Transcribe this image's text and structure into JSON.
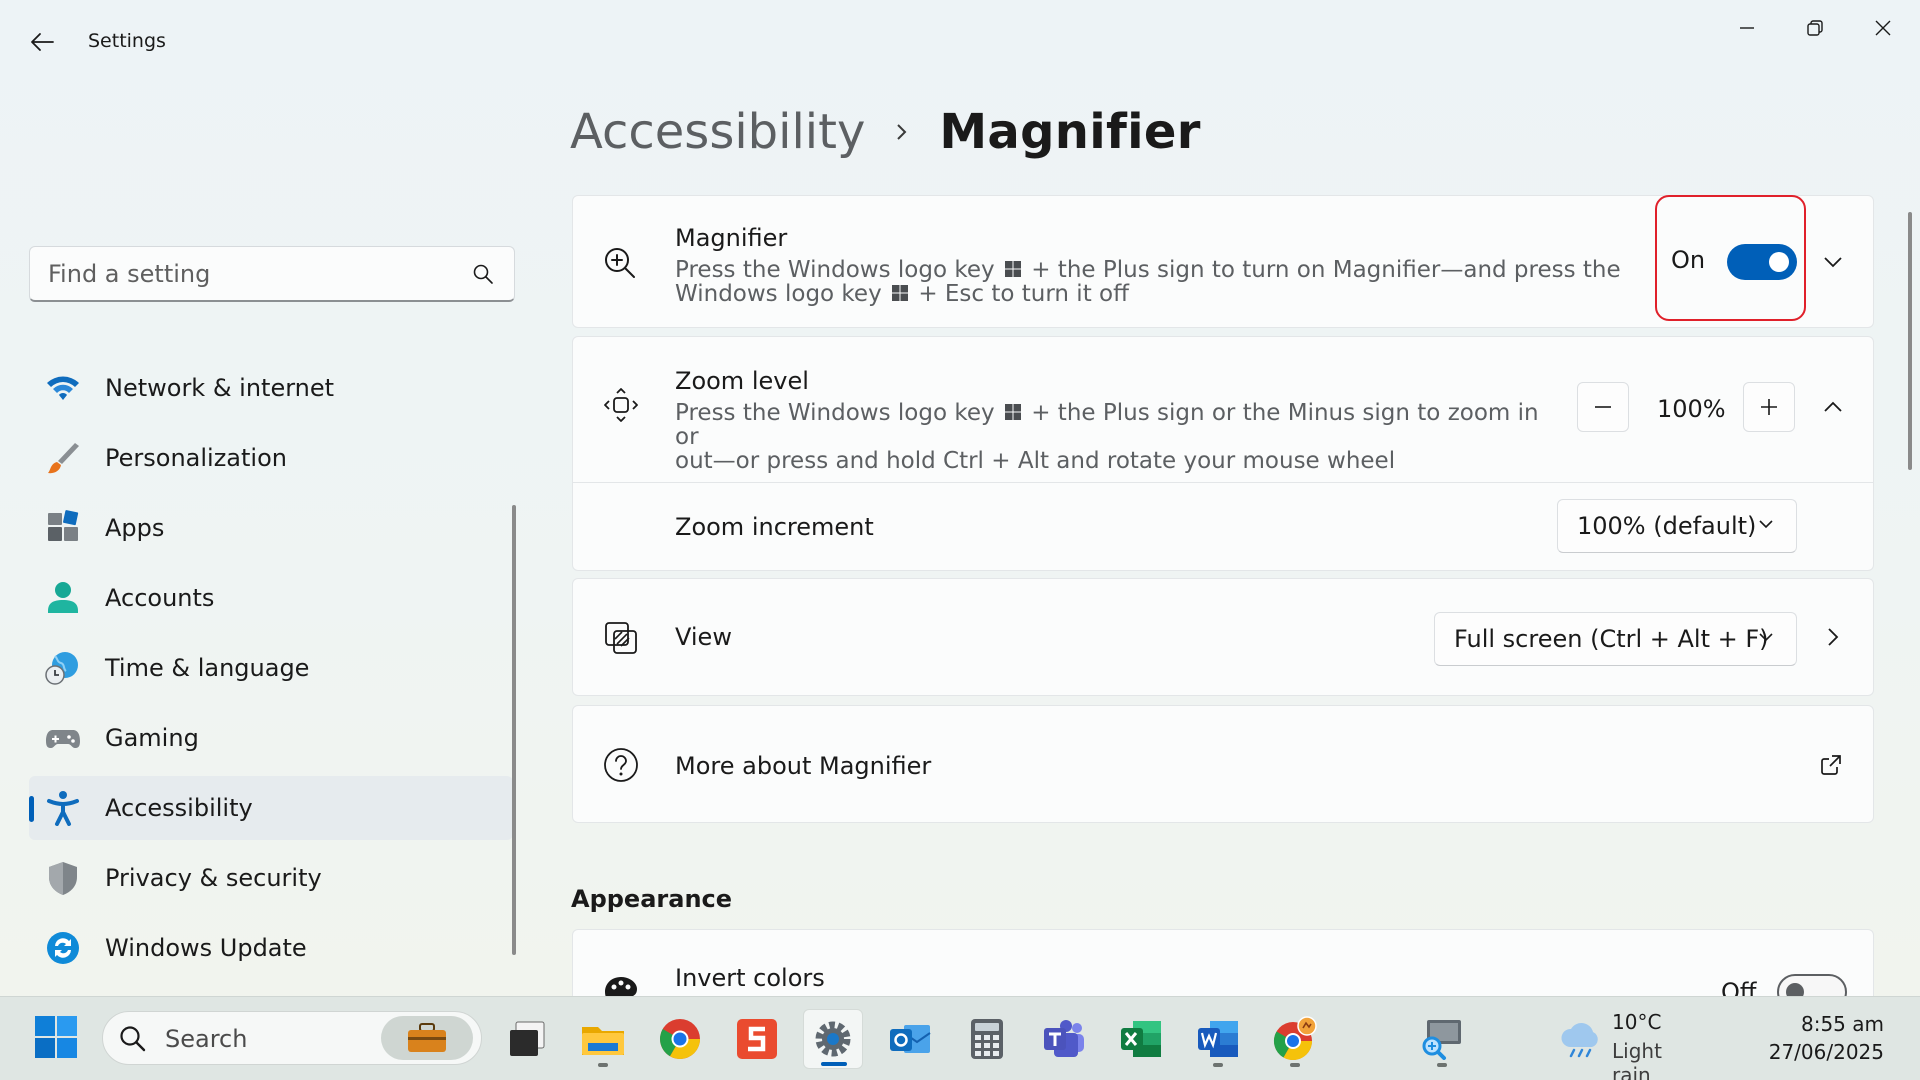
{
  "window": {
    "title": "Settings"
  },
  "search": {
    "placeholder": "Find a setting"
  },
  "nav": {
    "items": [
      {
        "label": "Network & internet"
      },
      {
        "label": "Personalization"
      },
      {
        "label": "Apps"
      },
      {
        "label": "Accounts"
      },
      {
        "label": "Time & language"
      },
      {
        "label": "Gaming"
      },
      {
        "label": "Accessibility",
        "selected": true
      },
      {
        "label": "Privacy & security"
      },
      {
        "label": "Windows Update"
      }
    ]
  },
  "breadcrumb": {
    "parent": "Accessibility",
    "current": "Magnifier"
  },
  "magnifier": {
    "title": "Magnifier",
    "desc_a": "Press the Windows logo key",
    "desc_b": "+ the Plus sign to turn on Magnifier—and press the",
    "desc_c": "Windows logo key",
    "desc_d": "+ Esc to turn it off",
    "toggle_label": "On",
    "toggle_state": true
  },
  "zoom": {
    "title": "Zoom level",
    "desc_a": "Press the Windows logo key",
    "desc_b": "+ the Plus sign or the Minus sign to zoom in or",
    "desc_c": "out—or press and hold Ctrl + Alt and rotate your mouse wheel",
    "value": "100%",
    "increment_label": "Zoom increment",
    "increment_value": "100% (default)"
  },
  "view": {
    "title": "View",
    "value": "Full screen (Ctrl + Alt + F)"
  },
  "more": {
    "title": "More about Magnifier"
  },
  "appearance": {
    "heading": "Appearance",
    "invert_title": "Invert colors",
    "invert_toggle_label": "Off",
    "invert_state": false
  },
  "taskbar": {
    "search_label": "Search",
    "weather_temp": "10°C",
    "weather_cond": "Light rain",
    "time": "8:55 am",
    "date": "27/06/2025"
  },
  "colors": {
    "accent": "#005fb8",
    "highlight": "#e0202a"
  }
}
